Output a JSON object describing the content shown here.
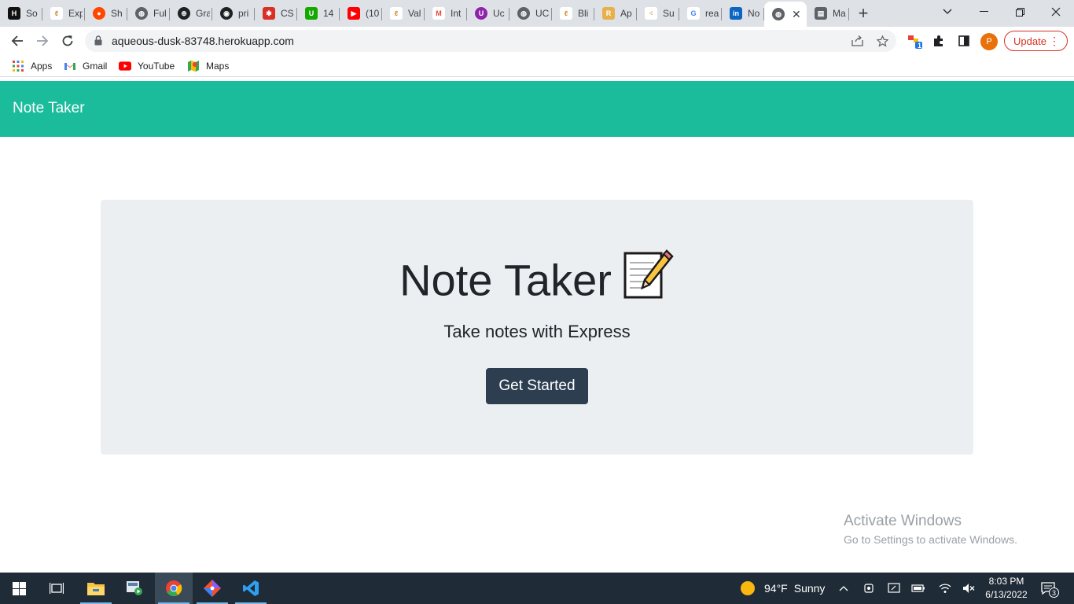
{
  "browser": {
    "tabs": [
      {
        "label": "So",
        "favicon": "hackerrank-icon",
        "color": "#111111"
      },
      {
        "label": "Exp",
        "favicon": "bootcamp-icon",
        "color": "#ffffff"
      },
      {
        "label": "Sh",
        "favicon": "reddit-icon",
        "color": "#ff4500"
      },
      {
        "label": "Ful",
        "favicon": "globe-icon",
        "color": "#5f6368"
      },
      {
        "label": "Gra",
        "favicon": "web-icon",
        "color": "#202124"
      },
      {
        "label": "pri",
        "favicon": "github-icon",
        "color": "#202124"
      },
      {
        "label": "CS",
        "favicon": "asterisk-icon",
        "color": "#d93025"
      },
      {
        "label": "14",
        "favicon": "upwork-icon",
        "color": "#14a800"
      },
      {
        "label": "(10",
        "favicon": "youtube-icon",
        "color": "#ff0000"
      },
      {
        "label": "Val",
        "favicon": "bootcamp-icon",
        "color": "#ffffff"
      },
      {
        "label": "Int",
        "favicon": "gmail-icon",
        "color": "#ffffff"
      },
      {
        "label": "Uc",
        "favicon": "purple-circle-icon",
        "color": "#8e24aa"
      },
      {
        "label": "UC",
        "favicon": "globe-icon",
        "color": "#5f6368"
      },
      {
        "label": "Bli",
        "favicon": "bootcamp-icon",
        "color": "#ffffff"
      },
      {
        "label": "Ap",
        "favicon": "r-icon",
        "color": "#e8b04a"
      },
      {
        "label": "Su",
        "favicon": "chart-dots-icon",
        "color": "#ffffff"
      },
      {
        "label": "rea",
        "favicon": "google-icon",
        "color": "#ffffff"
      },
      {
        "label": "No",
        "favicon": "linkedin-icon",
        "color": "#0a66c2"
      },
      {
        "label": "",
        "favicon": "globe-icon",
        "color": "#5f6368",
        "active": true
      },
      {
        "label": "Ma",
        "favicon": "document-icon",
        "color": "#5f6368"
      }
    ],
    "url": "aqueous-dusk-83748.herokuapp.com",
    "update_label": "Update",
    "profile_initial": "P",
    "extensions_badge": "1",
    "bookmarks": [
      {
        "label": "Apps",
        "icon": "apps-grid-icon"
      },
      {
        "label": "Gmail",
        "icon": "gmail-icon"
      },
      {
        "label": "YouTube",
        "icon": "youtube-icon"
      },
      {
        "label": "Maps",
        "icon": "maps-icon"
      }
    ]
  },
  "page": {
    "navbar_brand": "Note Taker",
    "heading": "Note Taker",
    "heading_emoji": "memo-icon",
    "lead": "Take notes with Express",
    "button_label": "Get Started",
    "accent_color": "#1abc9c",
    "button_color": "#2c3e50"
  },
  "watermark": {
    "line1": "Activate Windows",
    "line2": "Go to Settings to activate Windows."
  },
  "taskbar": {
    "weather_temp": "94°F",
    "weather_desc": "Sunny",
    "time": "8:03 PM",
    "date": "6/13/2022",
    "notification_count": "3"
  }
}
